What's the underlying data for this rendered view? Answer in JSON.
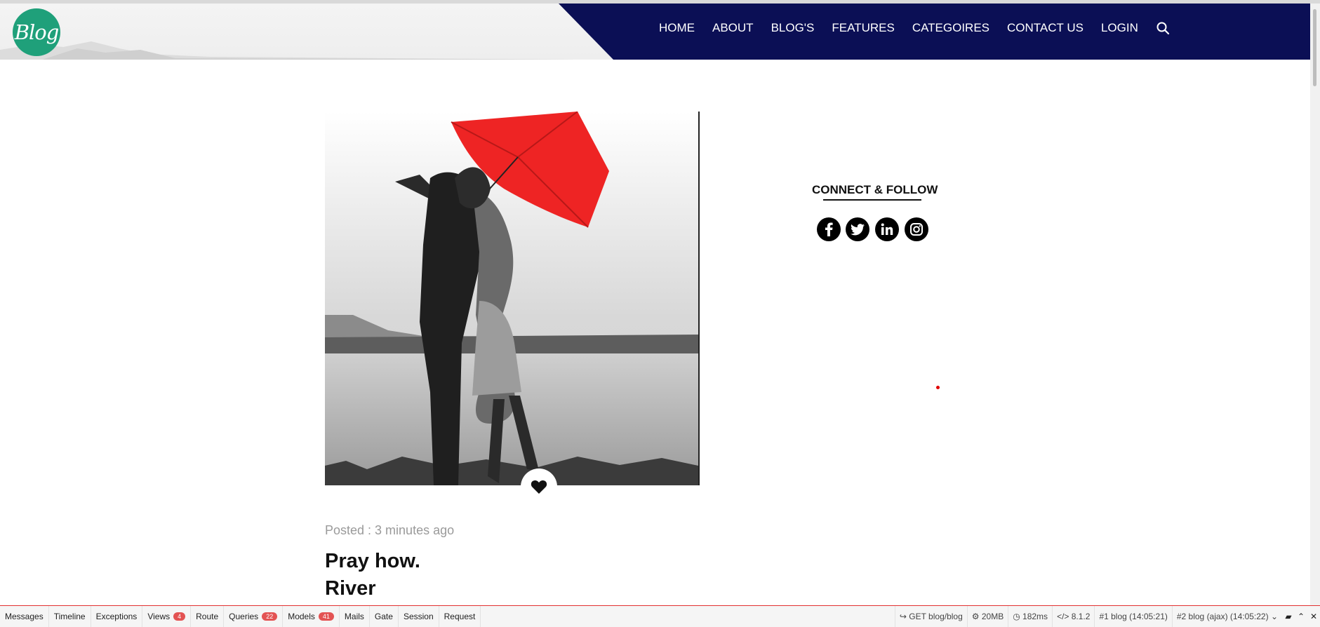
{
  "header": {
    "logo_text": "Blog",
    "nav": [
      "HOME",
      "ABOUT",
      "BLOG'S",
      "FEATURES",
      "CATEGOIRES",
      "CONTACT US",
      "LOGIN"
    ],
    "nav_bg_color": "#0b0f55",
    "logo_color": "#1fa07a"
  },
  "post": {
    "posted": "Posted : 3 minutes ago",
    "title_line1": "Pray how.",
    "title_line2": "River"
  },
  "sidebar": {
    "connect_title": "CONNECT & FOLLOW",
    "social": [
      "facebook-icon",
      "twitter-icon",
      "linkedin-icon",
      "instagram-icon"
    ]
  },
  "debugbar": {
    "tabs": [
      {
        "label": "Messages"
      },
      {
        "label": "Timeline"
      },
      {
        "label": "Exceptions"
      },
      {
        "label": "Views",
        "badge": "4"
      },
      {
        "label": "Route"
      },
      {
        "label": "Queries",
        "badge": "22"
      },
      {
        "label": "Models",
        "badge": "41"
      },
      {
        "label": "Mails"
      },
      {
        "label": "Gate"
      },
      {
        "label": "Session"
      },
      {
        "label": "Request"
      }
    ],
    "request": "GET blog/blog",
    "memory": "20MB",
    "time": "182ms",
    "php": "8.1.2",
    "request_id": "#1 blog (14:05:21)",
    "ajax_select": "#2 blog (ajax) (14:05:22)"
  }
}
